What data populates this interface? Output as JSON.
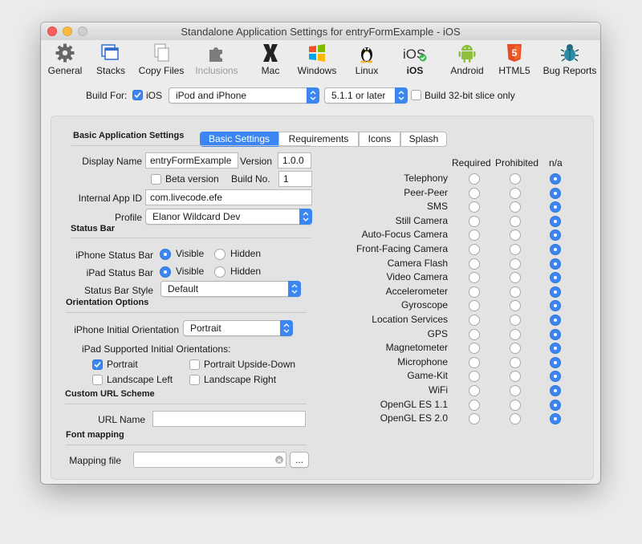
{
  "window": {
    "title": "Standalone Application Settings for entryFormExample - iOS"
  },
  "toolbar": {
    "items": [
      {
        "label": "General"
      },
      {
        "label": "Stacks"
      },
      {
        "label": "Copy Files"
      },
      {
        "label": "Inclusions"
      },
      {
        "label": "Mac"
      },
      {
        "label": "Windows"
      },
      {
        "label": "Linux"
      },
      {
        "label": "iOS"
      },
      {
        "label": "Android"
      },
      {
        "label": "HTML5"
      },
      {
        "label": "Bug Reports"
      }
    ],
    "selected": "iOS",
    "disabled": "Inclusions",
    "ios_icon_text": "iOS",
    "html5_icon_text": "5"
  },
  "build": {
    "label": "Build For:",
    "ios_checkbox": "iOS",
    "ios_checked": true,
    "device": "iPod and iPhone",
    "min_version": "5.1.1 or later",
    "slice_label": "Build 32-bit slice only",
    "slice_checked": false
  },
  "tabs": [
    {
      "label": "Basic Settings",
      "active": true
    },
    {
      "label": "Requirements",
      "active": false
    },
    {
      "label": "Icons",
      "active": false
    },
    {
      "label": "Splash",
      "active": false
    }
  ],
  "basic": {
    "header": "Basic Application Settings",
    "display_name_label": "Display Name",
    "display_name": "entryFormExample",
    "version_label": "Version",
    "version": "1.0.0",
    "beta_label": "Beta version",
    "beta_checked": false,
    "build_no_label": "Build No.",
    "build_no": "1",
    "app_id_label": "Internal App ID",
    "app_id": "com.livecode.efe",
    "profile_label": "Profile",
    "profile": "Elanor Wildcard Dev"
  },
  "status_bar": {
    "header": "Status Bar",
    "iphone_label": "iPhone Status Bar",
    "ipad_label": "iPad Status Bar",
    "visible": "Visible",
    "hidden": "Hidden",
    "iphone_value": "Visible",
    "ipad_value": "Visible",
    "style_label": "Status Bar Style",
    "style": "Default"
  },
  "orientation": {
    "header": "Orientation Options",
    "iphone_label": "iPhone Initial Orientation",
    "iphone_value": "Portrait",
    "ipad_label": "iPad Supported Initial Orientations:",
    "portrait": "Portrait",
    "portrait_checked": true,
    "upside_down": "Portrait Upside-Down",
    "upside_down_checked": false,
    "landscape_left": "Landscape Left",
    "landscape_left_checked": false,
    "landscape_right": "Landscape Right",
    "landscape_right_checked": false
  },
  "url_scheme": {
    "header": "Custom URL Scheme",
    "label": "URL Name",
    "value": ""
  },
  "font_mapping": {
    "header": "Font mapping",
    "label": "Mapping file",
    "value": "",
    "browse": "..."
  },
  "capabilities": {
    "columns": [
      "Required",
      "Prohibited",
      "n/a"
    ],
    "rows": [
      {
        "name": "Telephony",
        "value": "n/a"
      },
      {
        "name": "Peer-Peer",
        "value": "n/a"
      },
      {
        "name": "SMS",
        "value": "n/a"
      },
      {
        "name": "Still Camera",
        "value": "n/a"
      },
      {
        "name": "Auto-Focus Camera",
        "value": "n/a"
      },
      {
        "name": "Front-Facing Camera",
        "value": "n/a"
      },
      {
        "name": "Camera Flash",
        "value": "n/a"
      },
      {
        "name": "Video Camera",
        "value": "n/a"
      },
      {
        "name": "Accelerometer",
        "value": "n/a"
      },
      {
        "name": "Gyroscope",
        "value": "n/a"
      },
      {
        "name": "Location Services",
        "value": "n/a"
      },
      {
        "name": "GPS",
        "value": "n/a"
      },
      {
        "name": "Magnetometer",
        "value": "n/a"
      },
      {
        "name": "Microphone",
        "value": "n/a"
      },
      {
        "name": "Game-Kit",
        "value": "n/a"
      },
      {
        "name": "WiFi",
        "value": "n/a"
      },
      {
        "name": "OpenGL ES 1.1",
        "value": "n/a"
      },
      {
        "name": "OpenGL ES 2.0",
        "value": "n/a"
      }
    ]
  },
  "colors": {
    "accent": "#3b86f2",
    "close": "#fc605c",
    "minimize": "#fdbc40",
    "zoom": "#c9c9c9"
  }
}
